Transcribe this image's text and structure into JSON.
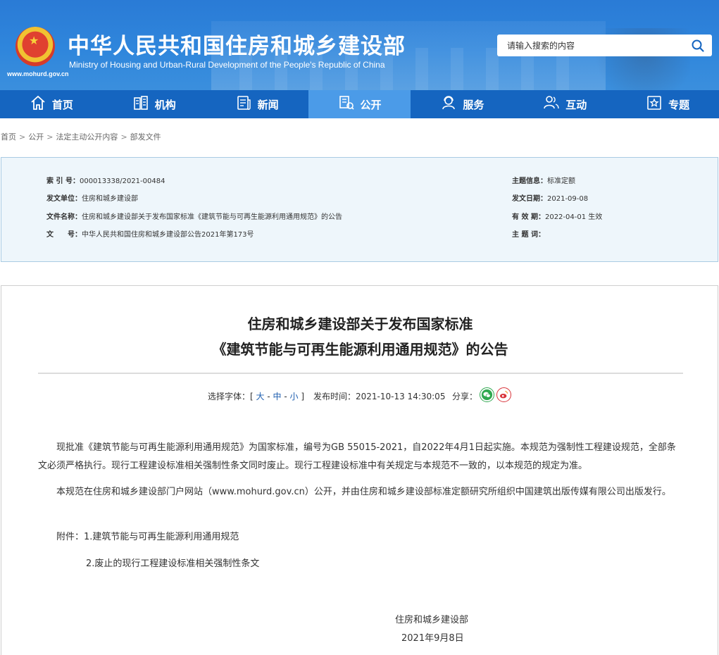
{
  "header": {
    "title": "中华人民共和国住房和城乡建设部",
    "subtitle": "Ministry of Housing and Urban-Rural Development of the People's Republic of China",
    "url": "www.mohurd.gov.cn",
    "search_placeholder": "请输入搜索的内容"
  },
  "nav": {
    "items": [
      {
        "label": "首页",
        "icon": "home-icon"
      },
      {
        "label": "机构",
        "icon": "building-icon"
      },
      {
        "label": "新闻",
        "icon": "news-icon"
      },
      {
        "label": "公开",
        "icon": "public-icon",
        "active": true
      },
      {
        "label": "服务",
        "icon": "service-icon"
      },
      {
        "label": "互动",
        "icon": "interact-icon"
      },
      {
        "label": "专题",
        "icon": "topic-icon"
      }
    ],
    "active_color": "#4b9be8",
    "bar_color": "#1565c0"
  },
  "breadcrumb": [
    "首页",
    "公开",
    "法定主动公开内容",
    "部发文件"
  ],
  "info": {
    "index_label": "索 引 号：",
    "index_value": "000013338/2021-00484",
    "issuer_label": "发文单位：",
    "issuer_value": "住房和城乡建设部",
    "filename_label": "文件名称：",
    "filename_value": "住房和城乡建设部关于发布国家标准《建筑节能与可再生能源利用通用规范》的公告",
    "docno_label": "文　　号：",
    "docno_value": "中华人民共和国住房和城乡建设部公告2021年第173号",
    "topic_label": "主题信息：",
    "topic_value": "标准定额",
    "date_label": "发文日期：",
    "date_value": "2021-09-08",
    "validity_label": "有 效 期：",
    "validity_value": "2022-04-01 生效",
    "keywords_label": "主 题 词："
  },
  "article": {
    "title_line1": "住房和城乡建设部关于发布国家标准",
    "title_line2": "《建筑节能与可再生能源利用通用规范》的公告",
    "font_select_prefix": "选择字体：[",
    "font_large": "大",
    "font_medium": "中",
    "font_small": "小",
    "font_select_suffix": "]",
    "dash": "-",
    "publish_time": "发布时间：2021-10-13 14:30:05",
    "share_label": "分享：",
    "paragraph1": "现批准《建筑节能与可再生能源利用通用规范》为国家标准，编号为GB 55015-2021，自2022年4月1日起实施。本规范为强制性工程建设规范，全部条文必须严格执行。现行工程建设标准相关强制性条文同时废止。现行工程建设标准中有关规定与本规范不一致的，以本规范的规定为准。",
    "paragraph2": "本规范在住房和城乡建设部门户网站（www.mohurd.gov.cn）公开，并由住房和城乡建设部标准定额研究所组织中国建筑出版传媒有限公司出版发行。",
    "attachment1": "附件：1.建筑节能与可再生能源利用通用规范",
    "attachment2": "2.废止的现行工程建设标准相关强制性条文",
    "signer": "住房和城乡建设部",
    "sign_date": "2021年9月8日"
  }
}
